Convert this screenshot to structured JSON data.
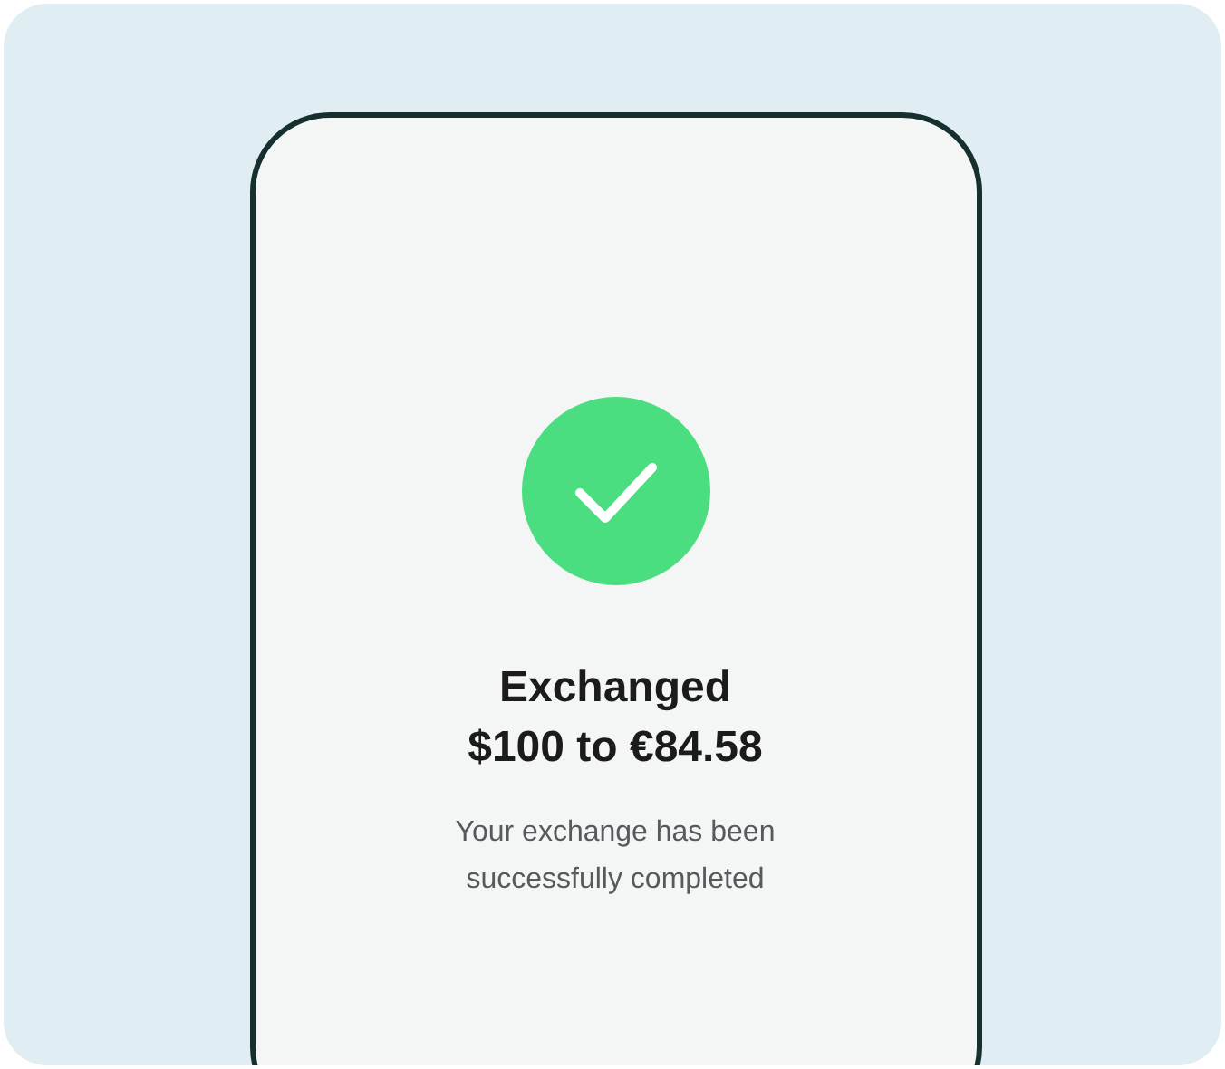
{
  "confirmation": {
    "title_lines": [
      "Exchanged",
      "$100 to €84.58"
    ],
    "message": "Your exchange has been successfully completed"
  }
}
